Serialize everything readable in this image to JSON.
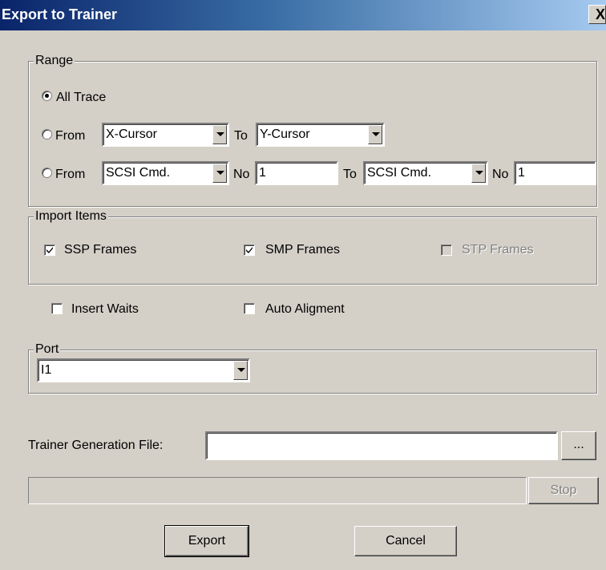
{
  "window": {
    "title": "Export to Trainer",
    "close_glyph": "X"
  },
  "range": {
    "legend": "Range",
    "all_trace": {
      "label": "All Trace",
      "selected": true
    },
    "row2": {
      "from_label": "From",
      "from_value": "X-Cursor",
      "to_label": "To",
      "to_value": "Y-Cursor",
      "selected": false
    },
    "row3": {
      "from_label": "From",
      "from_value": "SCSI Cmd.",
      "no_label": "No",
      "no_value": "1",
      "to_label": "To",
      "to_value": "SCSI Cmd.",
      "no2_label": "No",
      "no2_value": "1",
      "selected": false
    }
  },
  "import_items": {
    "legend": "Import Items",
    "ssp": {
      "label": "SSP Frames",
      "checked": true
    },
    "smp": {
      "label": "SMP Frames",
      "checked": true
    },
    "stp": {
      "label": "STP Frames",
      "checked": false,
      "disabled": true
    }
  },
  "options": {
    "insert_waits": {
      "label": "Insert Waits",
      "checked": false
    },
    "auto_alignment": {
      "label": "Auto Aligment",
      "checked": false
    }
  },
  "port": {
    "legend": "Port",
    "value": "I1"
  },
  "trainer_file": {
    "label": "Trainer Generation File:",
    "value": "",
    "browse_label": "..."
  },
  "progress": {
    "value": 0,
    "stop_label": "Stop"
  },
  "buttons": {
    "export_label": "Export",
    "cancel_label": "Cancel"
  },
  "colors": {
    "face": "#d4d0c8",
    "title_start": "#0a246a",
    "title_end": "#a6caf0"
  }
}
